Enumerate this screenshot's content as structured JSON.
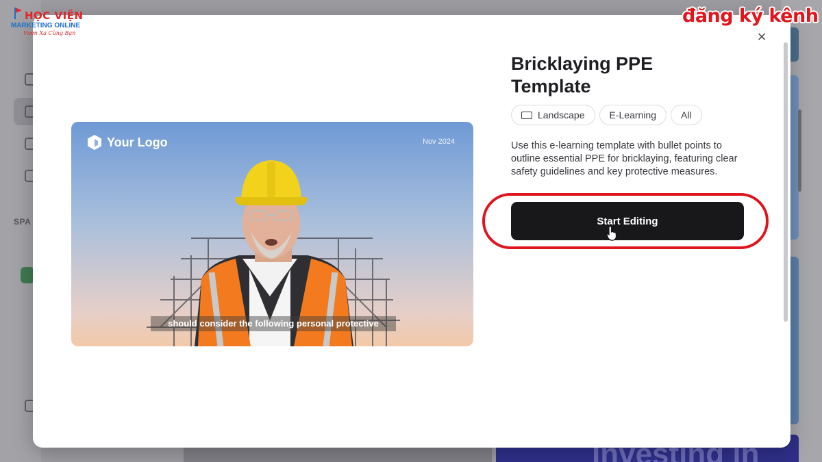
{
  "modal": {
    "title": "Bricklaying PPE Template",
    "tags": [
      {
        "label": "Landscape",
        "icon": "landscape-icon"
      },
      {
        "label": "E-Learning"
      },
      {
        "label": "All"
      }
    ],
    "description": "Use this e-learning template with bullet points to outline essential PPE for bricklaying, featuring clear safety guidelines and key protective measures.",
    "start_label": "Start Editing",
    "close_glyph": "×"
  },
  "preview": {
    "logo_text": "Your Logo",
    "date": "Nov 2024",
    "subtitle": "should consider the following personal protective"
  },
  "background": {
    "space_label": "SPA",
    "bottom_text": "Investing in"
  },
  "watermark": {
    "left_line1": "HỌC VIỆN",
    "left_line2": "MARKETING ONLINE",
    "left_line3": "Vươn Xa Cùng Bạn",
    "right_text": "đăng ký kênh"
  },
  "colors": {
    "primary_button": "#18181b",
    "annotation_red": "#e0141d",
    "hard_hat": "#f2d21b",
    "vest": "#f47a1f"
  }
}
